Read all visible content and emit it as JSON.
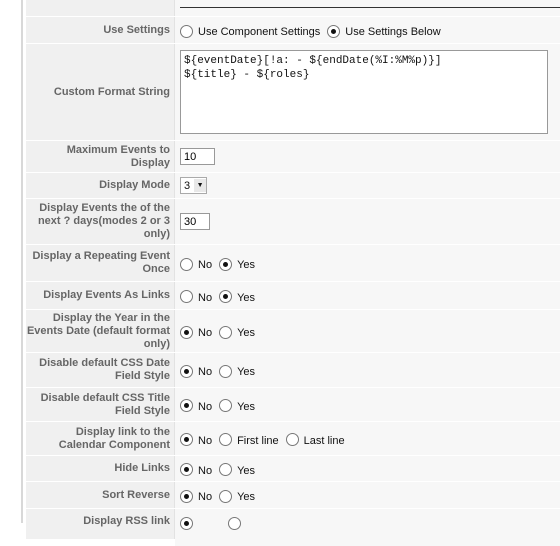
{
  "fields": [
    {
      "label": "Use Settings",
      "options": [
        "Use Component Settings",
        "Use Settings Below"
      ],
      "selected": 1
    },
    {
      "label": "Custom Format String",
      "value": "${eventDate}[!a: - ${endDate(%I:%M%p)}]\n${title} - ${roles}"
    },
    {
      "label": "Maximum Events to Display",
      "value": "10"
    },
    {
      "label": "Display Mode",
      "value": "3"
    },
    {
      "label": "Display Events the of the next ? days(modes 2 or 3 only)",
      "value": "30"
    },
    {
      "label": "Display a Repeating Event Once",
      "options": [
        "No",
        "Yes"
      ],
      "selected": 1
    },
    {
      "label": "Display Events As Links",
      "options": [
        "No",
        "Yes"
      ],
      "selected": 1
    },
    {
      "label": "Display the Year in the Events Date (default format only)",
      "options": [
        "No",
        "Yes"
      ],
      "selected": 0
    },
    {
      "label": "Disable default CSS Date Field Style",
      "options": [
        "No",
        "Yes"
      ],
      "selected": 0
    },
    {
      "label": "Disable default CSS Title Field Style",
      "options": [
        "No",
        "Yes"
      ],
      "selected": 0
    },
    {
      "label": "Display link to the Calendar Component",
      "options": [
        "No",
        "First line",
        "Last line"
      ],
      "selected": 0
    },
    {
      "label": "Hide Links",
      "options": [
        "No",
        "Yes"
      ],
      "selected": 0
    },
    {
      "label": "Sort Reverse",
      "options": [
        "No",
        "Yes"
      ],
      "selected": 0
    },
    {
      "label": "Display RSS link",
      "selected": 0
    }
  ]
}
